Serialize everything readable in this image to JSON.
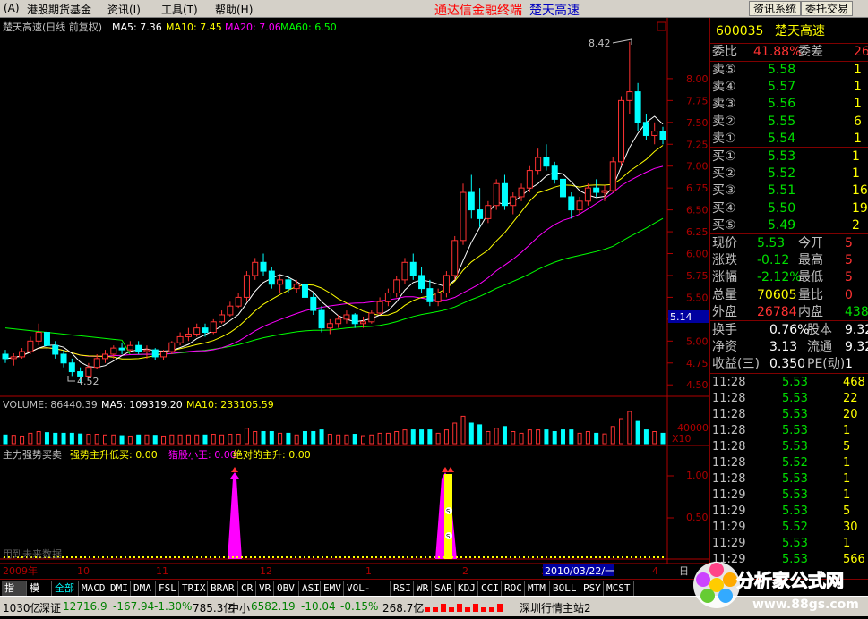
{
  "menu": {
    "items": [
      "(A)",
      "港股期货基金",
      "资讯(I)",
      "工具(T)",
      "帮助(H)"
    ],
    "center_title_red": "通达信金融终端",
    "center_title_blue": "楚天高速",
    "buttons": [
      "资讯系统",
      "委托交易"
    ]
  },
  "chart_header": {
    "title": "楚天高速(日线 前复权)",
    "ma5": "MA5: 7.36",
    "ma10": "MA10: 7.45",
    "ma20": "MA20: 7.06",
    "ma60": "MA60: 6.50"
  },
  "price_axis": {
    "ticks": [
      "8.00",
      "7.75",
      "7.50",
      "7.25",
      "7.00",
      "6.75",
      "6.50",
      "6.25",
      "6.00",
      "5.75",
      "5.50",
      "5.25",
      "5.00",
      "4.75",
      "4.50"
    ],
    "current": "5.14"
  },
  "annotations": {
    "high": "8.42",
    "low": "4.52"
  },
  "volume_header": {
    "volume": "VOLUME: 86440.39",
    "ma5": "MA5: 109319.20",
    "ma10": "MA10: 233105.59"
  },
  "volume_axis": {
    "tick": "40000",
    "unit": "X10"
  },
  "indicator_header": {
    "name": "主力强势买卖",
    "f1": "强势主升低买: 0.00",
    "f2": "猎股小王: 0.00",
    "f3": "绝对的主升: 0.00"
  },
  "indicator_axis": {
    "ticks": [
      "1.00",
      "0.50"
    ],
    "label_s": "S"
  },
  "watermark": "用到未来数据",
  "date_axis": {
    "labels": [
      "2009年",
      "10",
      "11",
      "12",
      "1",
      "2",
      "3",
      "4"
    ],
    "cursor_date": "2010/03/22/一",
    "right_label": "日"
  },
  "quote": {
    "code": "600035",
    "name": "楚天高速",
    "weibi_label": "委比",
    "weibi": "41.88%",
    "weicha_label": "委差",
    "weicha": "26",
    "sell": [
      {
        "label": "卖⑤",
        "price": "5.58",
        "vol": "1"
      },
      {
        "label": "卖④",
        "price": "5.57",
        "vol": "1"
      },
      {
        "label": "卖③",
        "price": "5.56",
        "vol": "1"
      },
      {
        "label": "卖②",
        "price": "5.55",
        "vol": "6"
      },
      {
        "label": "卖①",
        "price": "5.54",
        "vol": "1"
      }
    ],
    "buy": [
      {
        "label": "买①",
        "price": "5.53",
        "vol": "1"
      },
      {
        "label": "买②",
        "price": "5.52",
        "vol": "1"
      },
      {
        "label": "买③",
        "price": "5.51",
        "vol": "16"
      },
      {
        "label": "买④",
        "price": "5.50",
        "vol": "19"
      },
      {
        "label": "买⑤",
        "price": "5.49",
        "vol": "2"
      }
    ],
    "stats": [
      {
        "l1": "现价",
        "v1": "5.53",
        "l2": "今开",
        "v2": "5"
      },
      {
        "l1": "涨跌",
        "v1": "-0.12",
        "l2": "最高",
        "v2": "5"
      },
      {
        "l1": "涨幅",
        "v1": "-2.12%",
        "l2": "最低",
        "v2": "5"
      },
      {
        "l1": "总量",
        "v1": "70605",
        "l2": "量比",
        "v2": "0"
      },
      {
        "l1": "外盘",
        "v1": "26784",
        "l2": "内盘",
        "v2": "438"
      }
    ],
    "stats2": [
      {
        "l1": "换手",
        "v1": "0.76%",
        "l2": "股本",
        "v2": "9.32"
      },
      {
        "l1": "净资",
        "v1": "3.13",
        "l2": "流通",
        "v2": "9.32"
      },
      {
        "l1": "收益(三)",
        "v1": "0.350",
        "l2": "PE(动)",
        "v2": "1"
      }
    ],
    "ticks": [
      {
        "t": "11:28",
        "p": "5.53",
        "v": "468"
      },
      {
        "t": "11:28",
        "p": "5.53",
        "v": "22"
      },
      {
        "t": "11:28",
        "p": "5.53",
        "v": "20"
      },
      {
        "t": "11:28",
        "p": "5.53",
        "v": "1"
      },
      {
        "t": "11:28",
        "p": "5.53",
        "v": "5"
      },
      {
        "t": "11:28",
        "p": "5.52",
        "v": "1"
      },
      {
        "t": "11:28",
        "p": "5.53",
        "v": "1"
      },
      {
        "t": "11:29",
        "p": "5.53",
        "v": "1"
      },
      {
        "t": "11:29",
        "p": "5.53",
        "v": "5"
      },
      {
        "t": "11:29",
        "p": "5.52",
        "v": "30"
      },
      {
        "t": "11:29",
        "p": "5.53",
        "v": "1"
      },
      {
        "t": "11:29",
        "p": "5.53",
        "v": "566"
      }
    ]
  },
  "tabs": [
    "指标",
    "模板",
    "全部",
    "MACD",
    "DMI",
    "DMA",
    "FSL",
    "TRIX",
    "BRAR",
    "CR",
    "VR",
    "OBV",
    "ASI",
    "EMV",
    "VOL-TDX",
    "RSI",
    "WR",
    "SAR",
    "KDJ",
    "CCI",
    "ROC",
    "MTM",
    "BOLL",
    "PSY",
    "MCST"
  ],
  "status": {
    "s1": "1030亿",
    "s2_label": "深证",
    "s2_value": "12716.9",
    "s2_change": "-167.94",
    "s2_pct": "-1.30%",
    "s3": "785.3亿",
    "s4_label": "中小",
    "s4_value": "6582.19",
    "s4_change": "-10.04",
    "s4_pct": "-0.15%",
    "s5": "268.7亿",
    "s6": "深圳行情主站2"
  },
  "logo": {
    "text": "分析家公式网",
    "url": "www.88gs.com"
  },
  "colors": {
    "up": "#ff3232",
    "down": "#00ffff",
    "ma5": "#ffffff",
    "ma10": "#ffff00",
    "ma20": "#ff00ff",
    "ma60": "#00ff00",
    "axis": "#b00000"
  },
  "chart_data": {
    "type": "candlestick",
    "price_range": [
      4.4,
      8.5
    ],
    "candles": [
      [
        4.85,
        4.9,
        4.75,
        4.8
      ],
      [
        4.8,
        4.86,
        4.72,
        4.82
      ],
      [
        4.82,
        4.92,
        4.8,
        4.88
      ],
      [
        4.88,
        5.05,
        4.85,
        5.0
      ],
      [
        5.0,
        5.2,
        4.95,
        5.1
      ],
      [
        5.1,
        5.12,
        4.9,
        4.95
      ],
      [
        4.95,
        5.0,
        4.8,
        4.85
      ],
      [
        4.85,
        4.9,
        4.7,
        4.75
      ],
      [
        4.75,
        4.8,
        4.6,
        4.65
      ],
      [
        4.65,
        4.7,
        4.52,
        4.6
      ],
      [
        4.6,
        4.75,
        4.58,
        4.7
      ],
      [
        4.7,
        4.85,
        4.68,
        4.8
      ],
      [
        4.8,
        4.9,
        4.75,
        4.85
      ],
      [
        4.85,
        4.95,
        4.8,
        4.92
      ],
      [
        4.92,
        4.98,
        4.85,
        4.9
      ],
      [
        4.9,
        5.0,
        4.88,
        4.95
      ],
      [
        4.95,
        5.0,
        4.85,
        4.88
      ],
      [
        4.88,
        4.95,
        4.8,
        4.9
      ],
      [
        4.9,
        4.92,
        4.78,
        4.82
      ],
      [
        4.82,
        4.9,
        4.78,
        4.88
      ],
      [
        4.88,
        5.0,
        4.85,
        4.98
      ],
      [
        4.98,
        5.1,
        4.95,
        5.05
      ],
      [
        5.05,
        5.15,
        5.0,
        5.08
      ],
      [
        5.08,
        5.2,
        5.05,
        5.15
      ],
      [
        5.15,
        5.2,
        5.05,
        5.1
      ],
      [
        5.1,
        5.25,
        5.08,
        5.22
      ],
      [
        5.22,
        5.35,
        5.2,
        5.3
      ],
      [
        5.3,
        5.45,
        5.28,
        5.4
      ],
      [
        5.4,
        5.55,
        5.38,
        5.5
      ],
      [
        5.5,
        5.8,
        5.45,
        5.75
      ],
      [
        5.75,
        5.95,
        5.7,
        5.9
      ],
      [
        5.9,
        6.0,
        5.75,
        5.8
      ],
      [
        5.8,
        5.85,
        5.6,
        5.65
      ],
      [
        5.65,
        5.75,
        5.55,
        5.7
      ],
      [
        5.7,
        5.75,
        5.55,
        5.6
      ],
      [
        5.6,
        5.7,
        5.55,
        5.65
      ],
      [
        5.65,
        5.7,
        5.45,
        5.5
      ],
      [
        5.5,
        5.55,
        5.3,
        5.35
      ],
      [
        5.35,
        5.4,
        5.1,
        5.15
      ],
      [
        5.15,
        5.25,
        5.08,
        5.2
      ],
      [
        5.2,
        5.3,
        5.15,
        5.25
      ],
      [
        5.25,
        5.35,
        5.2,
        5.3
      ],
      [
        5.3,
        5.32,
        5.15,
        5.2
      ],
      [
        5.2,
        5.28,
        5.15,
        5.22
      ],
      [
        5.22,
        5.35,
        5.2,
        5.32
      ],
      [
        5.32,
        5.5,
        5.3,
        5.45
      ],
      [
        5.45,
        5.6,
        5.4,
        5.55
      ],
      [
        5.55,
        5.75,
        5.5,
        5.7
      ],
      [
        5.7,
        5.95,
        5.65,
        5.9
      ],
      [
        5.9,
        6.0,
        5.7,
        5.75
      ],
      [
        5.75,
        5.85,
        5.55,
        5.6
      ],
      [
        5.6,
        5.7,
        5.4,
        5.45
      ],
      [
        5.45,
        5.6,
        5.4,
        5.55
      ],
      [
        5.55,
        5.8,
        5.5,
        5.75
      ],
      [
        5.75,
        6.2,
        5.7,
        6.15
      ],
      [
        6.15,
        6.8,
        6.1,
        6.7
      ],
      [
        6.7,
        6.9,
        6.4,
        6.5
      ],
      [
        6.5,
        6.75,
        6.3,
        6.4
      ],
      [
        6.4,
        6.6,
        6.35,
        6.55
      ],
      [
        6.55,
        6.85,
        6.5,
        6.8
      ],
      [
        6.8,
        6.9,
        6.5,
        6.55
      ],
      [
        6.55,
        6.7,
        6.45,
        6.65
      ],
      [
        6.65,
        6.8,
        6.6,
        6.75
      ],
      [
        6.75,
        7.0,
        6.7,
        6.95
      ],
      [
        6.95,
        7.2,
        6.9,
        7.1
      ],
      [
        7.1,
        7.25,
        6.95,
        7.0
      ],
      [
        7.0,
        7.05,
        6.8,
        6.85
      ],
      [
        6.85,
        6.9,
        6.6,
        6.65
      ],
      [
        6.65,
        6.7,
        6.4,
        6.5
      ],
      [
        6.5,
        6.65,
        6.45,
        6.6
      ],
      [
        6.6,
        6.8,
        6.55,
        6.75
      ],
      [
        6.75,
        6.85,
        6.65,
        6.7
      ],
      [
        6.7,
        6.78,
        6.6,
        6.72
      ],
      [
        6.72,
        7.1,
        6.7,
        7.05
      ],
      [
        7.05,
        7.8,
        7.0,
        7.75
      ],
      [
        7.75,
        8.42,
        7.6,
        7.85
      ],
      [
        7.85,
        7.95,
        7.4,
        7.5
      ],
      [
        7.5,
        7.6,
        7.3,
        7.35
      ],
      [
        7.35,
        7.5,
        7.25,
        7.4
      ],
      [
        7.4,
        7.45,
        7.25,
        7.3
      ]
    ]
  }
}
